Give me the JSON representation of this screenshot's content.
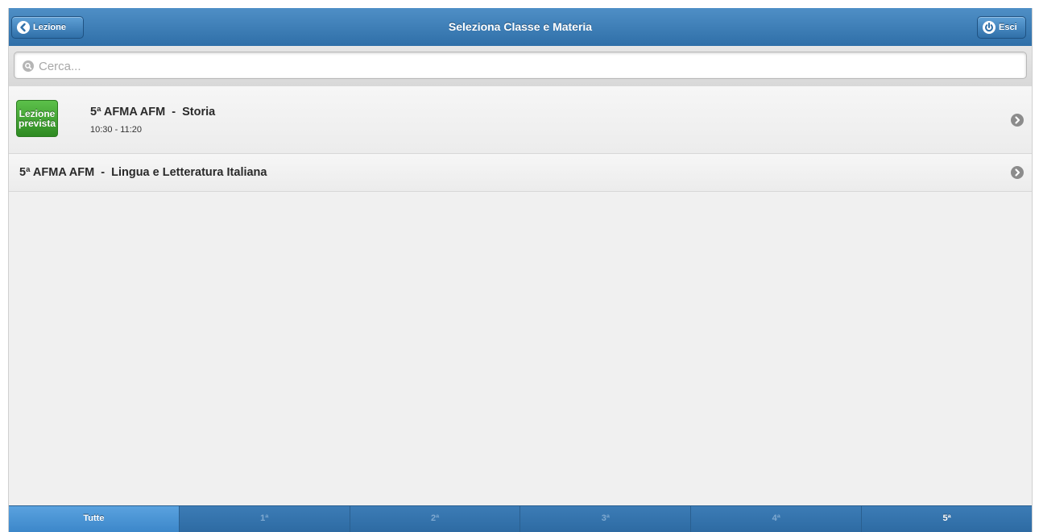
{
  "header": {
    "title": "Seleziona Classe e Materia",
    "back_label": "Lezione",
    "exit_label": "Esci"
  },
  "search": {
    "placeholder": "Cerca..."
  },
  "items": [
    {
      "badge_line1": "Lezione",
      "badge_line2": "prevista",
      "title": "5ª AFMA AFM  -  Storia",
      "time": "10:30 - 11:20"
    },
    {
      "title": "5ª AFMA AFM  -  Lingua e Letteratura Italiana"
    }
  ],
  "tabs": [
    {
      "label": "Tutte"
    },
    {
      "label": "1ª"
    },
    {
      "label": "2ª"
    },
    {
      "label": "3ª"
    },
    {
      "label": "4ª"
    },
    {
      "label": "5ª"
    }
  ],
  "colors": {
    "header": "#3b7db8",
    "badge_green": "#3f9e30",
    "tab_active": "#4a96d6"
  },
  "icons": {
    "back": "chevron-left-icon",
    "exit": "power-icon",
    "search": "search-icon",
    "row": "chevron-right-icon"
  }
}
